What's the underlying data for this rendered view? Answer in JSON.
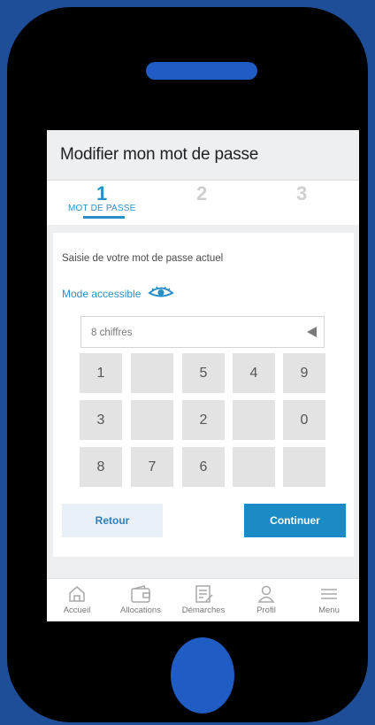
{
  "header": {
    "title": "Modifier mon mot de passe"
  },
  "steps": {
    "step1": "1",
    "step2": "2",
    "step3": "3",
    "active_label": "MOT DE PASSE"
  },
  "form": {
    "instruction": "Saisie de votre mot de passe actuel",
    "accessible_mode": "Mode accessible",
    "password_placeholder": "8 chiffres"
  },
  "keypad": {
    "rows": [
      [
        "1",
        "",
        "5",
        "4",
        "9"
      ],
      [
        "3",
        "",
        "2",
        "",
        "0"
      ],
      [
        "8",
        "7",
        "6",
        "",
        ""
      ]
    ]
  },
  "buttons": {
    "back": "Retour",
    "continue": "Continuer"
  },
  "bottom_nav": {
    "items": [
      {
        "label": "Accueil",
        "icon": "home-icon"
      },
      {
        "label": "Allocations",
        "icon": "wallet-icon"
      },
      {
        "label": "Démarches",
        "icon": "document-edit-icon"
      },
      {
        "label": "Profil",
        "icon": "user-icon"
      },
      {
        "label": "Menu",
        "icon": "hamburger-menu-icon"
      }
    ]
  },
  "colors": {
    "accent": "#2a8fc7",
    "primary_button": "#1a8bc5",
    "background": "#1f4e98"
  }
}
